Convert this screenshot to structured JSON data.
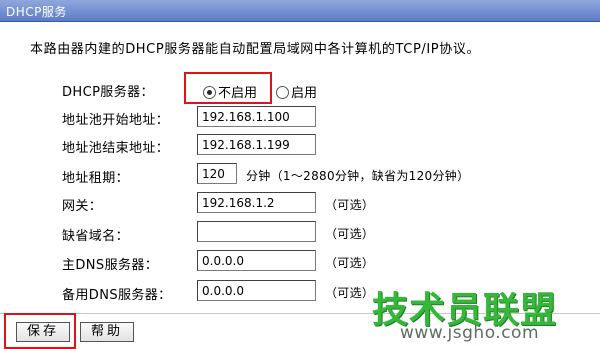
{
  "window": {
    "title": "DHCP服务"
  },
  "description": "本路由器内建的DHCP服务器能自动配置局域网中各计算机的TCP/IP协议。",
  "dhcp_server": {
    "label": "DHCP服务器：",
    "options": [
      {
        "label": "不启用",
        "selected": true
      },
      {
        "label": "启用",
        "selected": false
      }
    ]
  },
  "fields": {
    "pool_start": {
      "label": "地址池开始地址：",
      "value": "192.168.1.100"
    },
    "pool_end": {
      "label": "地址池结束地址：",
      "value": "192.168.1.199"
    },
    "lease": {
      "label": "地址租期：",
      "value": "120",
      "suffix": "分钟（1～2880分钟，缺省为120分钟）"
    },
    "gateway": {
      "label": "网关：",
      "value": "192.168.1.2",
      "suffix": "（可选）"
    },
    "domain": {
      "label": "缺省域名：",
      "value": "",
      "suffix": "（可选）"
    },
    "primary_dns": {
      "label": "主DNS服务器：",
      "value": "0.0.0.0",
      "suffix": "（可选）"
    },
    "secondary_dns": {
      "label": "备用DNS服务器：",
      "value": "0.0.0.0",
      "suffix": "（可选）"
    }
  },
  "buttons": {
    "save": "保存",
    "help": "帮助"
  },
  "watermark": {
    "main": "技术员联盟",
    "url": "www.jsgho.com"
  },
  "colors": {
    "titlebar": "#5d7cc8",
    "highlight": "#d8141c",
    "watermark": "#35b83a"
  }
}
